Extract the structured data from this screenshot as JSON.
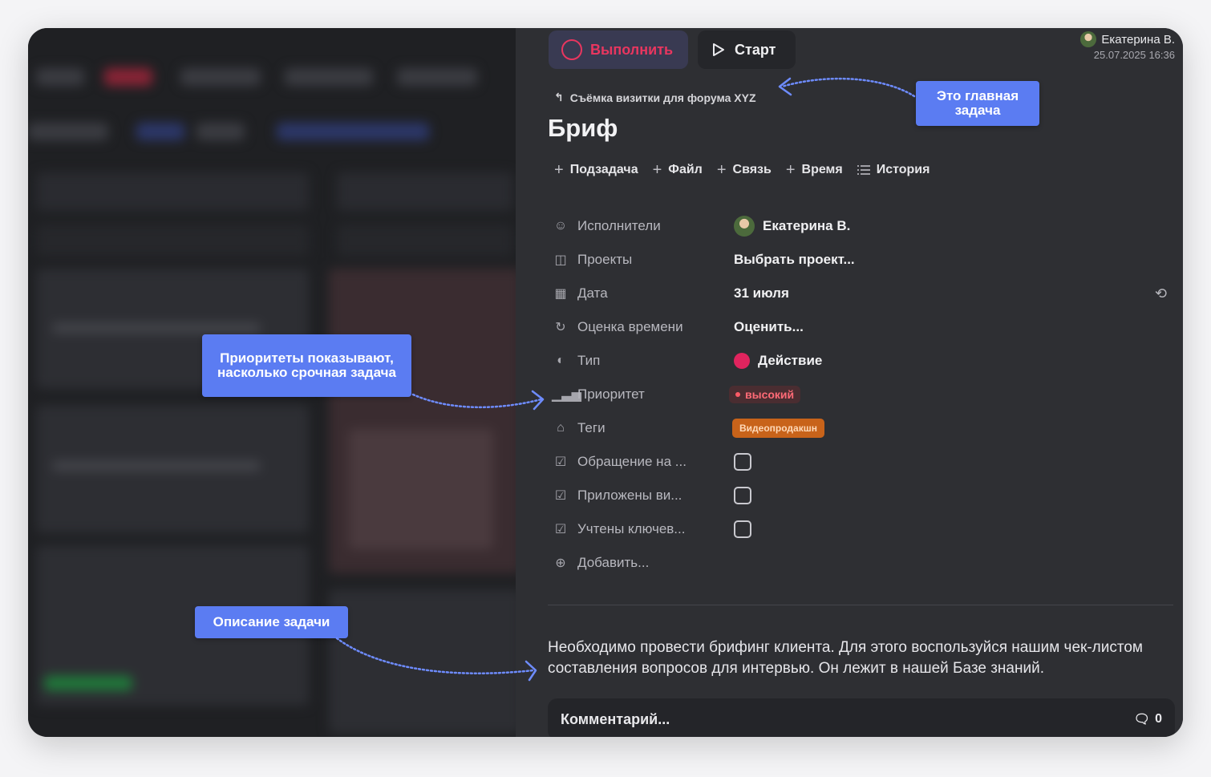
{
  "header": {
    "done_label": "Выполнить",
    "start_label": "Старт",
    "user_name": "Екатерина В.",
    "timestamp": "25.07.2025 16:36"
  },
  "task": {
    "parent_title": "Съёмка визитки для форума XYZ",
    "title": "Бриф"
  },
  "actions": [
    "Подзадача",
    "Файл",
    "Связь",
    "Время",
    "История"
  ],
  "properties": {
    "assignees": {
      "label": "Исполнители",
      "value": "Екатерина В."
    },
    "projects": {
      "label": "Проекты",
      "value": "Выбрать проект..."
    },
    "date": {
      "label": "Дата",
      "value": "31 июля"
    },
    "estimate": {
      "label": "Оценка времени",
      "value": "Оценить..."
    },
    "type": {
      "label": "Тип",
      "value": "Действие"
    },
    "priority": {
      "label": "Приоритет",
      "value": "высокий"
    },
    "tags": {
      "label": "Теги",
      "value": "Видеопродакшн"
    },
    "check1": {
      "label": "Обращение на ..."
    },
    "check2": {
      "label": "Приложены ви..."
    },
    "check3": {
      "label": "Учтены ключев..."
    },
    "add": {
      "label": "Добавить..."
    }
  },
  "description": "Необходимо провести брифинг клиента. Для этого воспользуйся нашим чек-листом составления вопросов для интервью. Он лежит в нашей Базе знаний.",
  "comment": {
    "placeholder": "Комментарий...",
    "count": "0"
  },
  "callouts": {
    "main_task": "Это главная задача",
    "priority": "Приоритеты показывают, насколько срочная задача",
    "description": "Описание задачи"
  },
  "colors": {
    "accent": "#5b7cf2",
    "done": "#e8365f",
    "priority_high": "#ff5a66",
    "tag": "#c8631a"
  }
}
